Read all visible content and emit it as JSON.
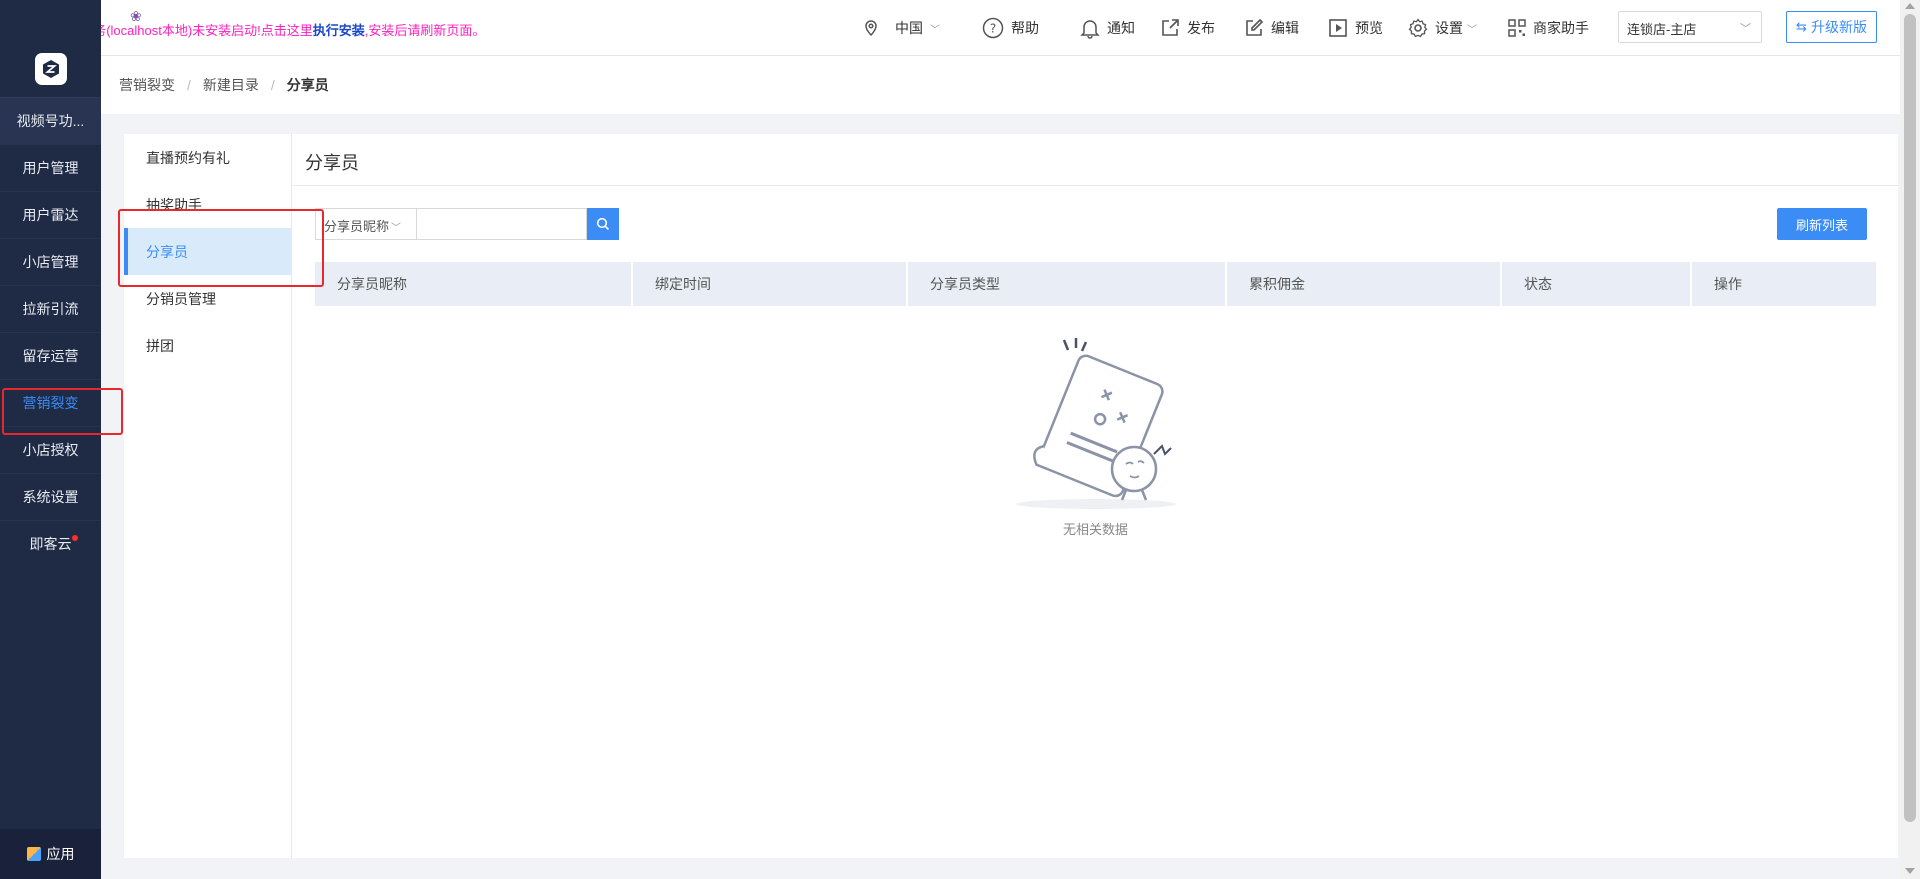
{
  "header": {
    "print_warning_prefix": "Clodop云打印服务(localhost本地)未安装启动!点击这里",
    "print_warning_link": "执行安装",
    "print_warning_suffix": ",安装后请刷新页面。",
    "region": "中国",
    "help": "帮助",
    "notify": "通知",
    "publish": "发布",
    "edit": "编辑",
    "preview": "预览",
    "settings": "设置",
    "assistant": "商家助手",
    "store": "连锁店-主店",
    "upgrade": "升级新版"
  },
  "sidebar": {
    "items": [
      {
        "label": "视频号功..."
      },
      {
        "label": "用户管理"
      },
      {
        "label": "用户雷达"
      },
      {
        "label": "小店管理"
      },
      {
        "label": "拉新引流"
      },
      {
        "label": "留存运营"
      },
      {
        "label": "营销裂变"
      },
      {
        "label": "小店授权"
      },
      {
        "label": "系统设置"
      },
      {
        "label": "即客云"
      }
    ],
    "bottom": "应用"
  },
  "breadcrumb": {
    "items": [
      "营销裂变",
      "新建目录",
      "分享员"
    ]
  },
  "submenu": {
    "items": [
      {
        "label": "直播预约有礼"
      },
      {
        "label": "抽奖助手"
      },
      {
        "label": "分享员"
      },
      {
        "label": "分销员管理"
      },
      {
        "label": "拼团"
      }
    ]
  },
  "main": {
    "title": "分享员",
    "search_type": "分享员昵称",
    "search_value": "",
    "refresh": "刷新列表",
    "columns": [
      "分享员昵称",
      "绑定时间",
      "分享员类型",
      "累积佣金",
      "状态",
      "操作"
    ],
    "empty_text": "无相关数据"
  },
  "colors": {
    "sidebar_bg": "#1f2a44",
    "accent": "#3b8cf5",
    "warning": "#ff1fbf",
    "annotation": "#e8282b"
  }
}
